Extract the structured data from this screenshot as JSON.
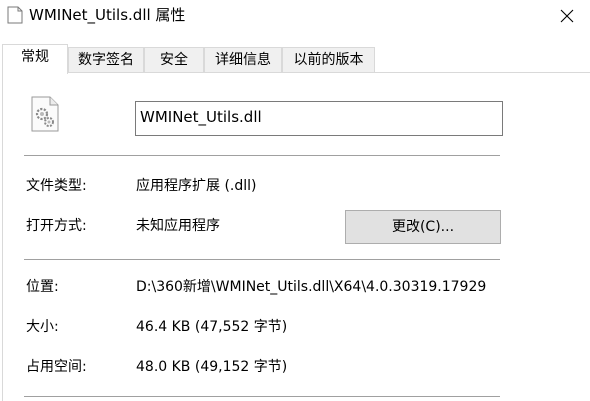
{
  "window": {
    "title": "WMINet_Utils.dll 属性",
    "close_icon": "close-icon",
    "title_icon": "document-icon"
  },
  "tabs": [
    {
      "label": "常规",
      "active": true
    },
    {
      "label": "数字签名",
      "active": false
    },
    {
      "label": "安全",
      "active": false
    },
    {
      "label": "详细信息",
      "active": false
    },
    {
      "label": "以前的版本",
      "active": false
    }
  ],
  "general": {
    "file_icon": "dll-gear-file-icon",
    "file_name": "WMINet_Utils.dll",
    "file_type_label": "文件类型:",
    "file_type_value": "应用程序扩展 (.dll)",
    "opens_with_label": "打开方式:",
    "opens_with_value": "未知应用程序",
    "change_button": "更改(C)...",
    "location_label": "位置:",
    "location_value": "D:\\360新增\\WMINet_Utils.dll\\X64\\4.0.30319.17929",
    "size_label": "大小:",
    "size_value": "46.4 KB (47,552 字节)",
    "size_on_disk_label": "占用空间:",
    "size_on_disk_value": "48.0 KB (49,152 字节)"
  },
  "colors": {
    "tab_inactive_bg": "#f0f0f0",
    "button_bg": "#e1e1e1",
    "separator": "#a0a0a0"
  }
}
